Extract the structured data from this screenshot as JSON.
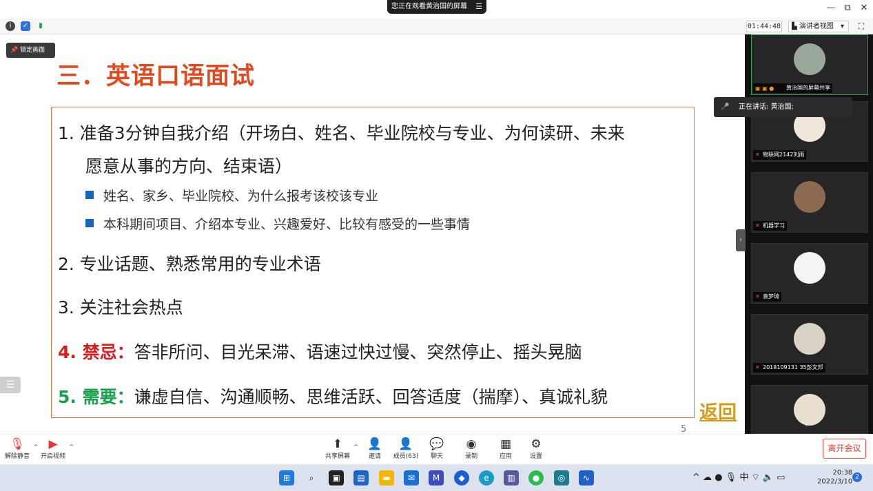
{
  "share_banner": {
    "text": "您正在观看黄治国的屏幕",
    "menu_icon": "menu-icon"
  },
  "window_controls": {
    "minimize": "—",
    "restore": "⧉",
    "close": "✕"
  },
  "toolbar": {
    "timer": "01:44:48",
    "presenter_view": "演讲者视图",
    "presenter_caret": "▾"
  },
  "lock_button": "锁定画面",
  "slide": {
    "title": "三．英语口语面试",
    "item1_line1": "1.  准备3分钟自我介绍（开场白、姓名、毕业院校与专业、为何读研、未来",
    "item1_line2": "愿意从事的方向、结束语）",
    "sub1": "姓名、家乡、毕业院校、为什么报考该校该专业",
    "sub2": "本科期间项目、介绍本专业、兴趣爱好、比较有感受的一些事情",
    "item2": "2.  专业话题、熟悉常用的专业术语",
    "item3": "3.  关注社会热点",
    "item4_label": "4.  禁忌：",
    "item4_text": "答非所问、目光呆滞、语速过快过慢、突然停止、摇头晃脑",
    "item5_label": "5.  需要：",
    "item5_text": "谦虚自信、沟通顺畅、思维活跃、回答适度（揣摩）、真诚礼貌",
    "page_number": "5",
    "return_link": "返回"
  },
  "speaking": "正在讲话: 黄治国;",
  "participants": [
    {
      "name": "黄治国的屏幕共享"
    },
    {
      "name": "物联网2142刘雨"
    },
    {
      "name": "机器学习"
    },
    {
      "name": "袁梦琦"
    },
    {
      "name": "2018109131 35彭文邦"
    },
    {
      "name": ""
    }
  ],
  "meeting_bar": {
    "unmute": "解除静音",
    "start_video": "开启视频",
    "share_screen": "共享屏幕",
    "invite": "邀请",
    "members": "成员(63)",
    "chat": "聊天",
    "record": "录制",
    "apps": "应用",
    "settings": "设置",
    "leave": "离开会议"
  },
  "taskbar": {
    "time": "20:38",
    "date": "2022/3/10",
    "notifications": "2",
    "ime": "中"
  }
}
